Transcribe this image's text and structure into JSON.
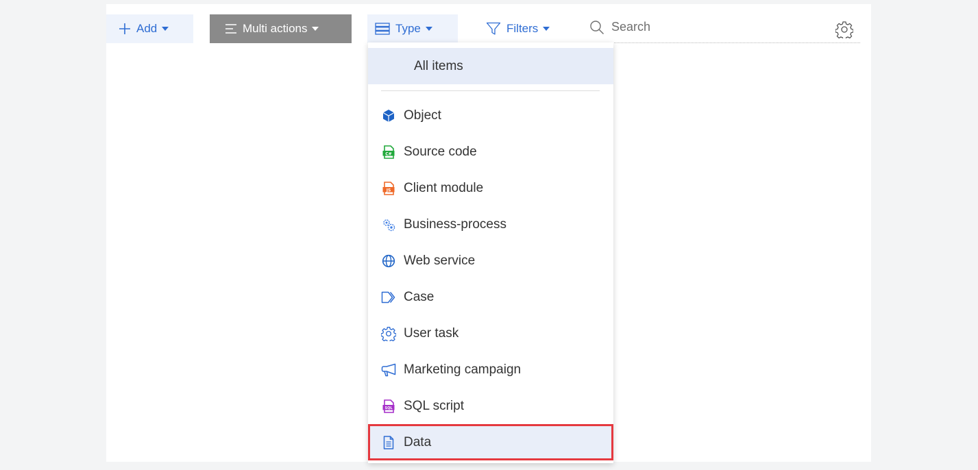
{
  "toolbar": {
    "add_label": "Add",
    "multi_actions_label": "Multi actions",
    "type_label": "Type",
    "filters_label": "Filters",
    "search_placeholder": "Search"
  },
  "type_menu": {
    "all_items_label": "All items",
    "items": [
      {
        "label": "Object",
        "icon": "object-cube-icon",
        "color": "#1e63c6"
      },
      {
        "label": "Source code",
        "icon": "source-code-csharp-icon",
        "color": "#22a93c"
      },
      {
        "label": "Client module",
        "icon": "client-module-js-icon",
        "color": "#ef6a2a"
      },
      {
        "label": "Business-process",
        "icon": "business-process-gears-icon",
        "color": "#3f7ee3"
      },
      {
        "label": "Web service",
        "icon": "web-service-globe-icon",
        "color": "#1e63c6"
      },
      {
        "label": "Case",
        "icon": "case-chevron-icon",
        "color": "#2f6dd3"
      },
      {
        "label": "User task",
        "icon": "user-task-gear-icon",
        "color": "#2f6dd3"
      },
      {
        "label": "Marketing campaign",
        "icon": "marketing-megaphone-icon",
        "color": "#2f6dd3"
      },
      {
        "label": "SQL script",
        "icon": "sql-script-icon",
        "color": "#a52fc9"
      },
      {
        "label": "Data",
        "icon": "data-document-icon",
        "color": "#2f6dd3"
      }
    ],
    "highlight_color": "#e5393f"
  }
}
